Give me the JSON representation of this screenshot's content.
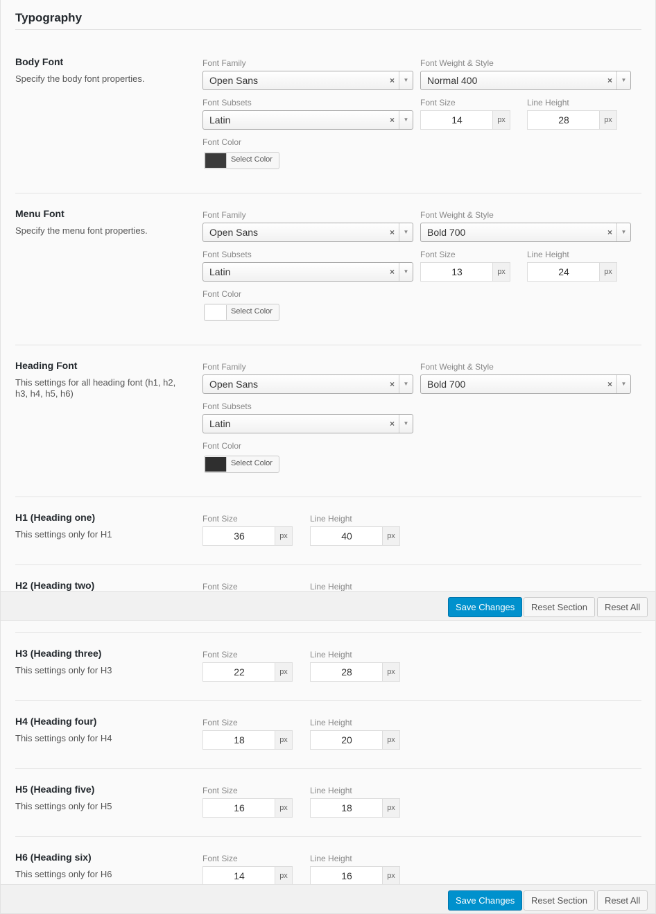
{
  "page": {
    "title": "Typography"
  },
  "labels": {
    "font_family": "Font Family",
    "font_weight_style": "Font Weight & Style",
    "font_subsets": "Font Subsets",
    "font_size": "Font Size",
    "line_height": "Line Height",
    "font_color": "Font Color",
    "select_color": "Select Color",
    "px": "px",
    "clear": "×",
    "arrow": "▼"
  },
  "body_font": {
    "title": "Body Font",
    "desc": "Specify the body font properties.",
    "family": "Open Sans",
    "weight": "Normal 400",
    "subset": "Latin",
    "size": "14",
    "line_height": "28",
    "color": "#3a3a3a"
  },
  "menu_font": {
    "title": "Menu Font",
    "desc": "Specify the menu font properties.",
    "family": "Open Sans",
    "weight": "Bold 700",
    "subset": "Latin",
    "size": "13",
    "line_height": "24",
    "color": "#ffffff"
  },
  "heading_font": {
    "title": "Heading Font",
    "desc": "This settings for all heading font (h1, h2, h3, h4, h5, h6)",
    "family": "Open Sans",
    "weight": "Bold 700",
    "subset": "Latin",
    "color": "#2f2f2f"
  },
  "h1": {
    "title": "H1 (Heading one)",
    "desc": "This settings only for H1",
    "size": "36",
    "line_height": "40"
  },
  "h2": {
    "title": "H2 (Heading two)"
  },
  "h3": {
    "title": "H3 (Heading three)",
    "desc": "This settings only for H3",
    "size": "22",
    "line_height": "28"
  },
  "h4": {
    "title": "H4 (Heading four)",
    "desc": "This settings only for H4",
    "size": "18",
    "line_height": "20"
  },
  "h5": {
    "title": "H5 (Heading five)",
    "desc": "This settings only for H5",
    "size": "16",
    "line_height": "18"
  },
  "h6": {
    "title": "H6 (Heading six)",
    "desc": "This settings only for H6",
    "size": "14",
    "line_height": "16"
  },
  "footer": {
    "save": "Save Changes",
    "reset_section": "Reset Section",
    "reset_all": "Reset All"
  }
}
